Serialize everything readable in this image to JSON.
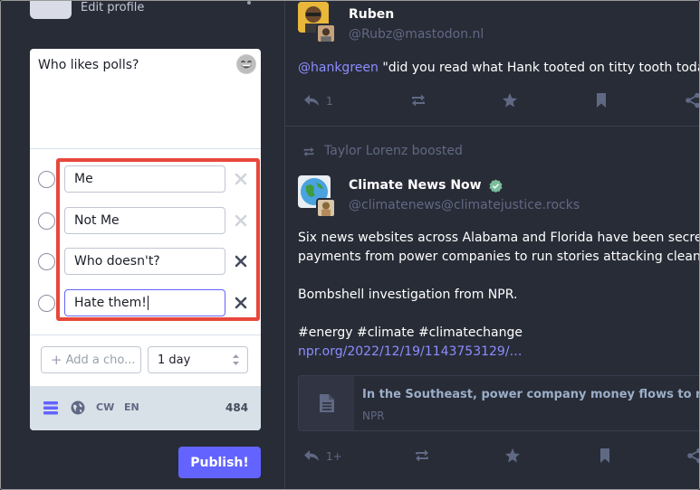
{
  "sidebar": {
    "edit_profile": "Edit profile"
  },
  "composer": {
    "text": "Who likes polls?",
    "poll_options": [
      "Me",
      "Not Me",
      "Who doesn't?",
      "Hate them!"
    ],
    "add_choice_placeholder": "Add a cho...",
    "duration": "1 day",
    "cw_label": "CW",
    "lang_label": "EN",
    "char_count": "484",
    "publish_label": "Publish!"
  },
  "feed": {
    "post1": {
      "name": "Ruben",
      "handle": "@Rubz@mastodon.nl",
      "mention": "@hankgreen",
      "text": " \"did you read what Hank tooted on titty tooth today?\"",
      "reply_count": "1"
    },
    "boost_line": "Taylor Lorenz boosted",
    "post2": {
      "name": "Climate News Now",
      "handle": "@climatenews@climatejustice.rocks",
      "line1": "Six news websites across Alabama and Florida have been secretly t",
      "line2": "payments from power companies to run stories attacking clean ene",
      "line3": "Bombshell investigation from NPR.",
      "line4": "#energy #climate #climatechange",
      "link": "npr.org/2022/12/19/1143753129/…",
      "card_title": "In the Southeast, power company money flows to news sites",
      "card_source": "NPR",
      "reply_count": "1+"
    }
  },
  "colors": {
    "accent": "#6364ff",
    "highlight": "#e8473b",
    "background": "#282c37",
    "verified": "#79bd9a"
  }
}
